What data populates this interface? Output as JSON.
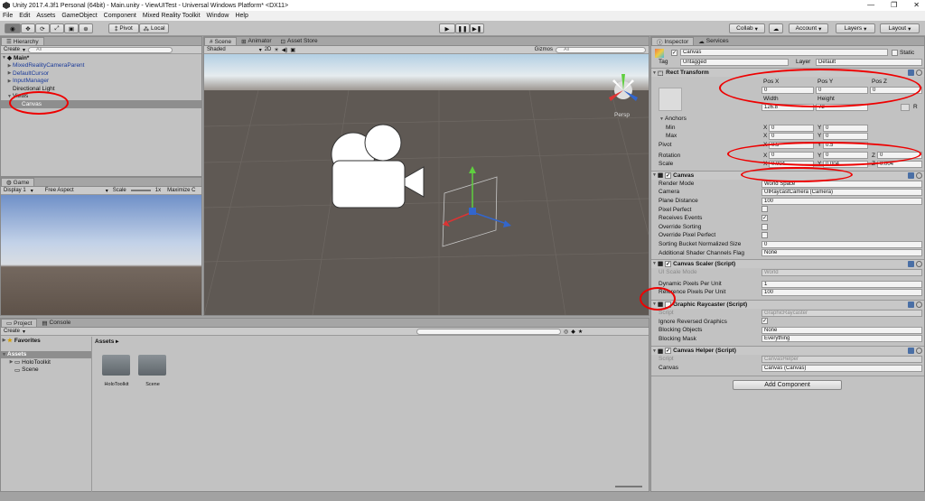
{
  "window": {
    "title": "Unity 2017.4.3f1 Personal (64bit) - Main.unity - ViewUITest - Universal Windows Platform* <DX11>",
    "minimize": "—",
    "maximize": "❐",
    "close": "✕"
  },
  "menu": [
    "File",
    "Edit",
    "Assets",
    "GameObject",
    "Component",
    "Mixed Reality Toolkit",
    "Window",
    "Help"
  ],
  "toolbar": {
    "pivot": "Pivot",
    "local": "Local",
    "collab": "Collab",
    "account": "Account",
    "layers": "Layers",
    "layout": "Layout"
  },
  "hierarchy": {
    "tab": "Hierarchy",
    "create": "Create",
    "search": "All",
    "scene": "Main*",
    "items": [
      "MixedRealityCameraParent",
      "DefaultCursor",
      "InputManager",
      "Directional Light",
      "Views",
      "Canvas"
    ]
  },
  "scene": {
    "tabs": [
      "Scene",
      "Animator",
      "Asset Store"
    ],
    "shading": "Shaded",
    "mode2d": "2D",
    "gizmos": "Gizmos",
    "search": "All",
    "persp": "Persp"
  },
  "game": {
    "tab": "Game",
    "display": "Display 1",
    "aspect": "Free Aspect",
    "scale_label": "Scale",
    "scale_value": "1x",
    "maximize": "Maximize C"
  },
  "project": {
    "tabs": [
      "Project",
      "Console"
    ],
    "create": "Create",
    "favorites": "Favorites",
    "assets": "Assets",
    "tree": [
      "HoloToolkit",
      "Scene"
    ],
    "breadcrumb": "Assets",
    "folders": [
      "HoloToolkit",
      "Scene"
    ]
  },
  "inspector": {
    "tabs": [
      "Inspector",
      "Services"
    ],
    "name": "Canvas",
    "static": "Static",
    "tag_label": "Tag",
    "tag": "Untagged",
    "layer_label": "Layer",
    "layer": "Default",
    "rect": {
      "title": "Rect Transform",
      "posx_l": "Pos X",
      "posy_l": "Pos Y",
      "posz_l": "Pos Z",
      "posx": "0",
      "posy": "0",
      "posz": "0",
      "width_l": "Width",
      "height_l": "Height",
      "width": "126.8",
      "height": "72",
      "anchors": "Anchors",
      "min": "Min",
      "max": "Max",
      "pivot": "Pivot",
      "min_x": "0",
      "min_y": "0",
      "max_x": "0",
      "max_y": "0",
      "pivot_x": "0.5",
      "pivot_y": "0.5",
      "rotation": "Rotation",
      "rot_x": "0",
      "rot_y": "0",
      "rot_z": "0",
      "scale": "Scale",
      "scale_x": "0.004",
      "scale_y": "0.004",
      "scale_z": "0.004",
      "x": "X",
      "y": "Y",
      "z": "Z",
      "r": "R"
    },
    "canvas": {
      "title": "Canvas",
      "render_mode_l": "Render Mode",
      "render_mode": "World Space",
      "camera_l": "Camera",
      "camera": "UIRaycastCamera (Camera)",
      "plane_l": "Plane Distance",
      "plane": "100",
      "pixel_perfect": "Pixel Perfect",
      "receives": "Receives Events",
      "override_sort": "Override Sorting",
      "override_pp": "Override Pixel Perfect",
      "sorting_l": "Sorting Bucket Normalized Size",
      "sorting": "0",
      "shader_l": "Additional Shader Channels Flag",
      "shader": "None"
    },
    "scaler": {
      "title": "Canvas Scaler (Script)",
      "ui_scale_l": "UI Scale Mode",
      "ui_scale": "World",
      "dyn_l": "Dynamic Pixels Per Unit",
      "dyn": "1",
      "ref_l": "Reference Pixels Per Unit",
      "ref": "100"
    },
    "raycaster": {
      "title": "Graphic Raycaster (Script)",
      "script_l": "Script",
      "script": "GraphicRaycaster",
      "ignore_l": "Ignore Reversed Graphics",
      "blocking_l": "Blocking Objects",
      "blocking": "None",
      "mask_l": "Blocking Mask",
      "mask": "Everything"
    },
    "helper": {
      "title": "Canvas Helper (Script)",
      "script_l": "Script",
      "script": "CanvasHelper",
      "canvas_l": "Canvas",
      "canvas": "Canvas (Canvas)"
    },
    "add_component": "Add Component"
  }
}
